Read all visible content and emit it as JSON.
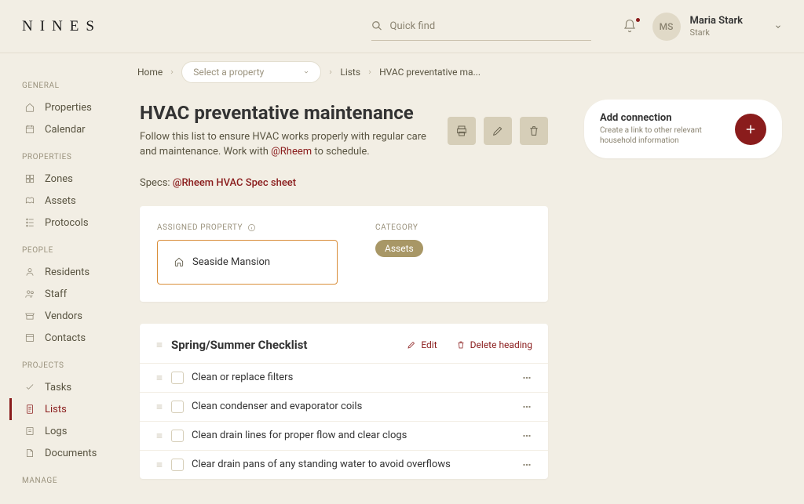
{
  "brand": "NINES",
  "search": {
    "placeholder": "Quick find"
  },
  "user": {
    "initials": "MS",
    "name": "Maria Stark",
    "sub": "Stark"
  },
  "sidebar": {
    "groups": [
      {
        "label": "GENERAL",
        "items": [
          {
            "label": "Properties"
          },
          {
            "label": "Calendar"
          }
        ]
      },
      {
        "label": "PROPERTIES",
        "items": [
          {
            "label": "Zones"
          },
          {
            "label": "Assets"
          },
          {
            "label": "Protocols"
          }
        ]
      },
      {
        "label": "PEOPLE",
        "items": [
          {
            "label": "Residents"
          },
          {
            "label": "Staff"
          },
          {
            "label": "Vendors"
          },
          {
            "label": "Contacts"
          }
        ]
      },
      {
        "label": "PROJECTS",
        "items": [
          {
            "label": "Tasks"
          },
          {
            "label": "Lists",
            "active": true
          },
          {
            "label": "Logs"
          },
          {
            "label": "Documents"
          }
        ]
      },
      {
        "label": "MANAGE",
        "items": []
      }
    ]
  },
  "breadcrumb": {
    "home": "Home",
    "select_property": "Select a property",
    "lists": "Lists",
    "current": "HVAC preventative ma..."
  },
  "page": {
    "title": "HVAC preventative maintenance",
    "desc_pre": "Follow this list to ensure HVAC works properly with regular care and maintenance. Work with ",
    "desc_mention": "@Rheem",
    "desc_post": " to schedule.",
    "specs_label": "Specs: ",
    "specs_link": "@Rheem HVAC Spec sheet"
  },
  "assigned": {
    "label": "ASSIGNED PROPERTY",
    "property": "Seaside Mansion",
    "cat_label": "CATEGORY",
    "cat_value": "Assets"
  },
  "checklist": {
    "heading": "Spring/Summer Checklist",
    "edit": "Edit",
    "delete": "Delete heading",
    "items": [
      "Clean or replace filters",
      "Clean condenser and evaporator coils",
      "Clean drain lines for proper flow and clear clogs",
      "Clear drain pans of any standing water to avoid overflows"
    ]
  },
  "connection": {
    "title": "Add connection",
    "sub": "Create a link to other relevant household information"
  }
}
